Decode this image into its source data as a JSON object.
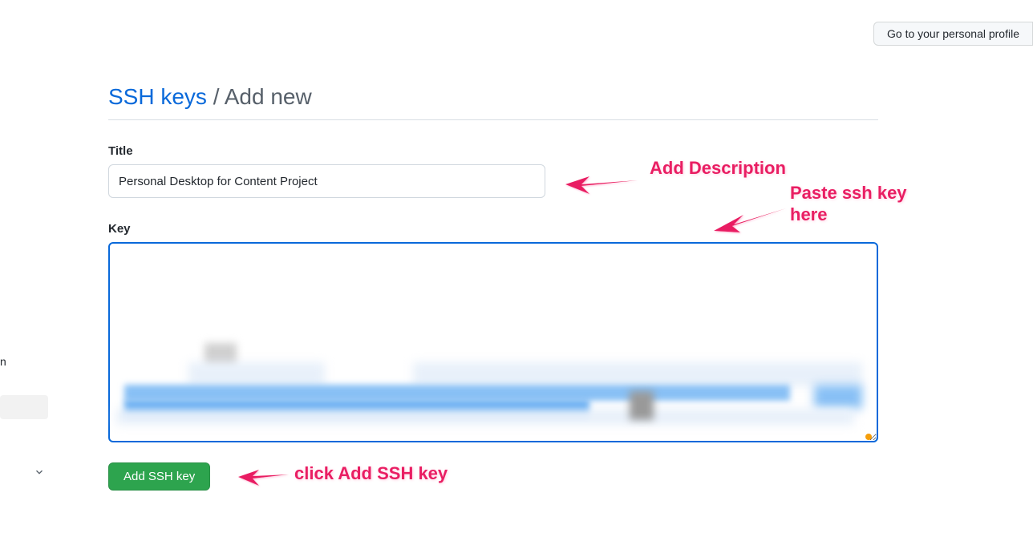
{
  "header": {
    "profile_button_label": "Go to your personal profile"
  },
  "breadcrumb": {
    "parent": "SSH keys",
    "separator": " / ",
    "current": "Add new"
  },
  "form": {
    "title_label": "Title",
    "title_value": "Personal Desktop for Content Project",
    "key_label": "Key",
    "submit_label": "Add SSH key"
  },
  "annotations": {
    "add_description": "Add Description",
    "paste_ssh_key_line1": "Paste ssh key",
    "paste_ssh_key_line2": "here",
    "click_add": "click Add SSH key"
  },
  "sidebar": {
    "fragment_char": "n"
  }
}
